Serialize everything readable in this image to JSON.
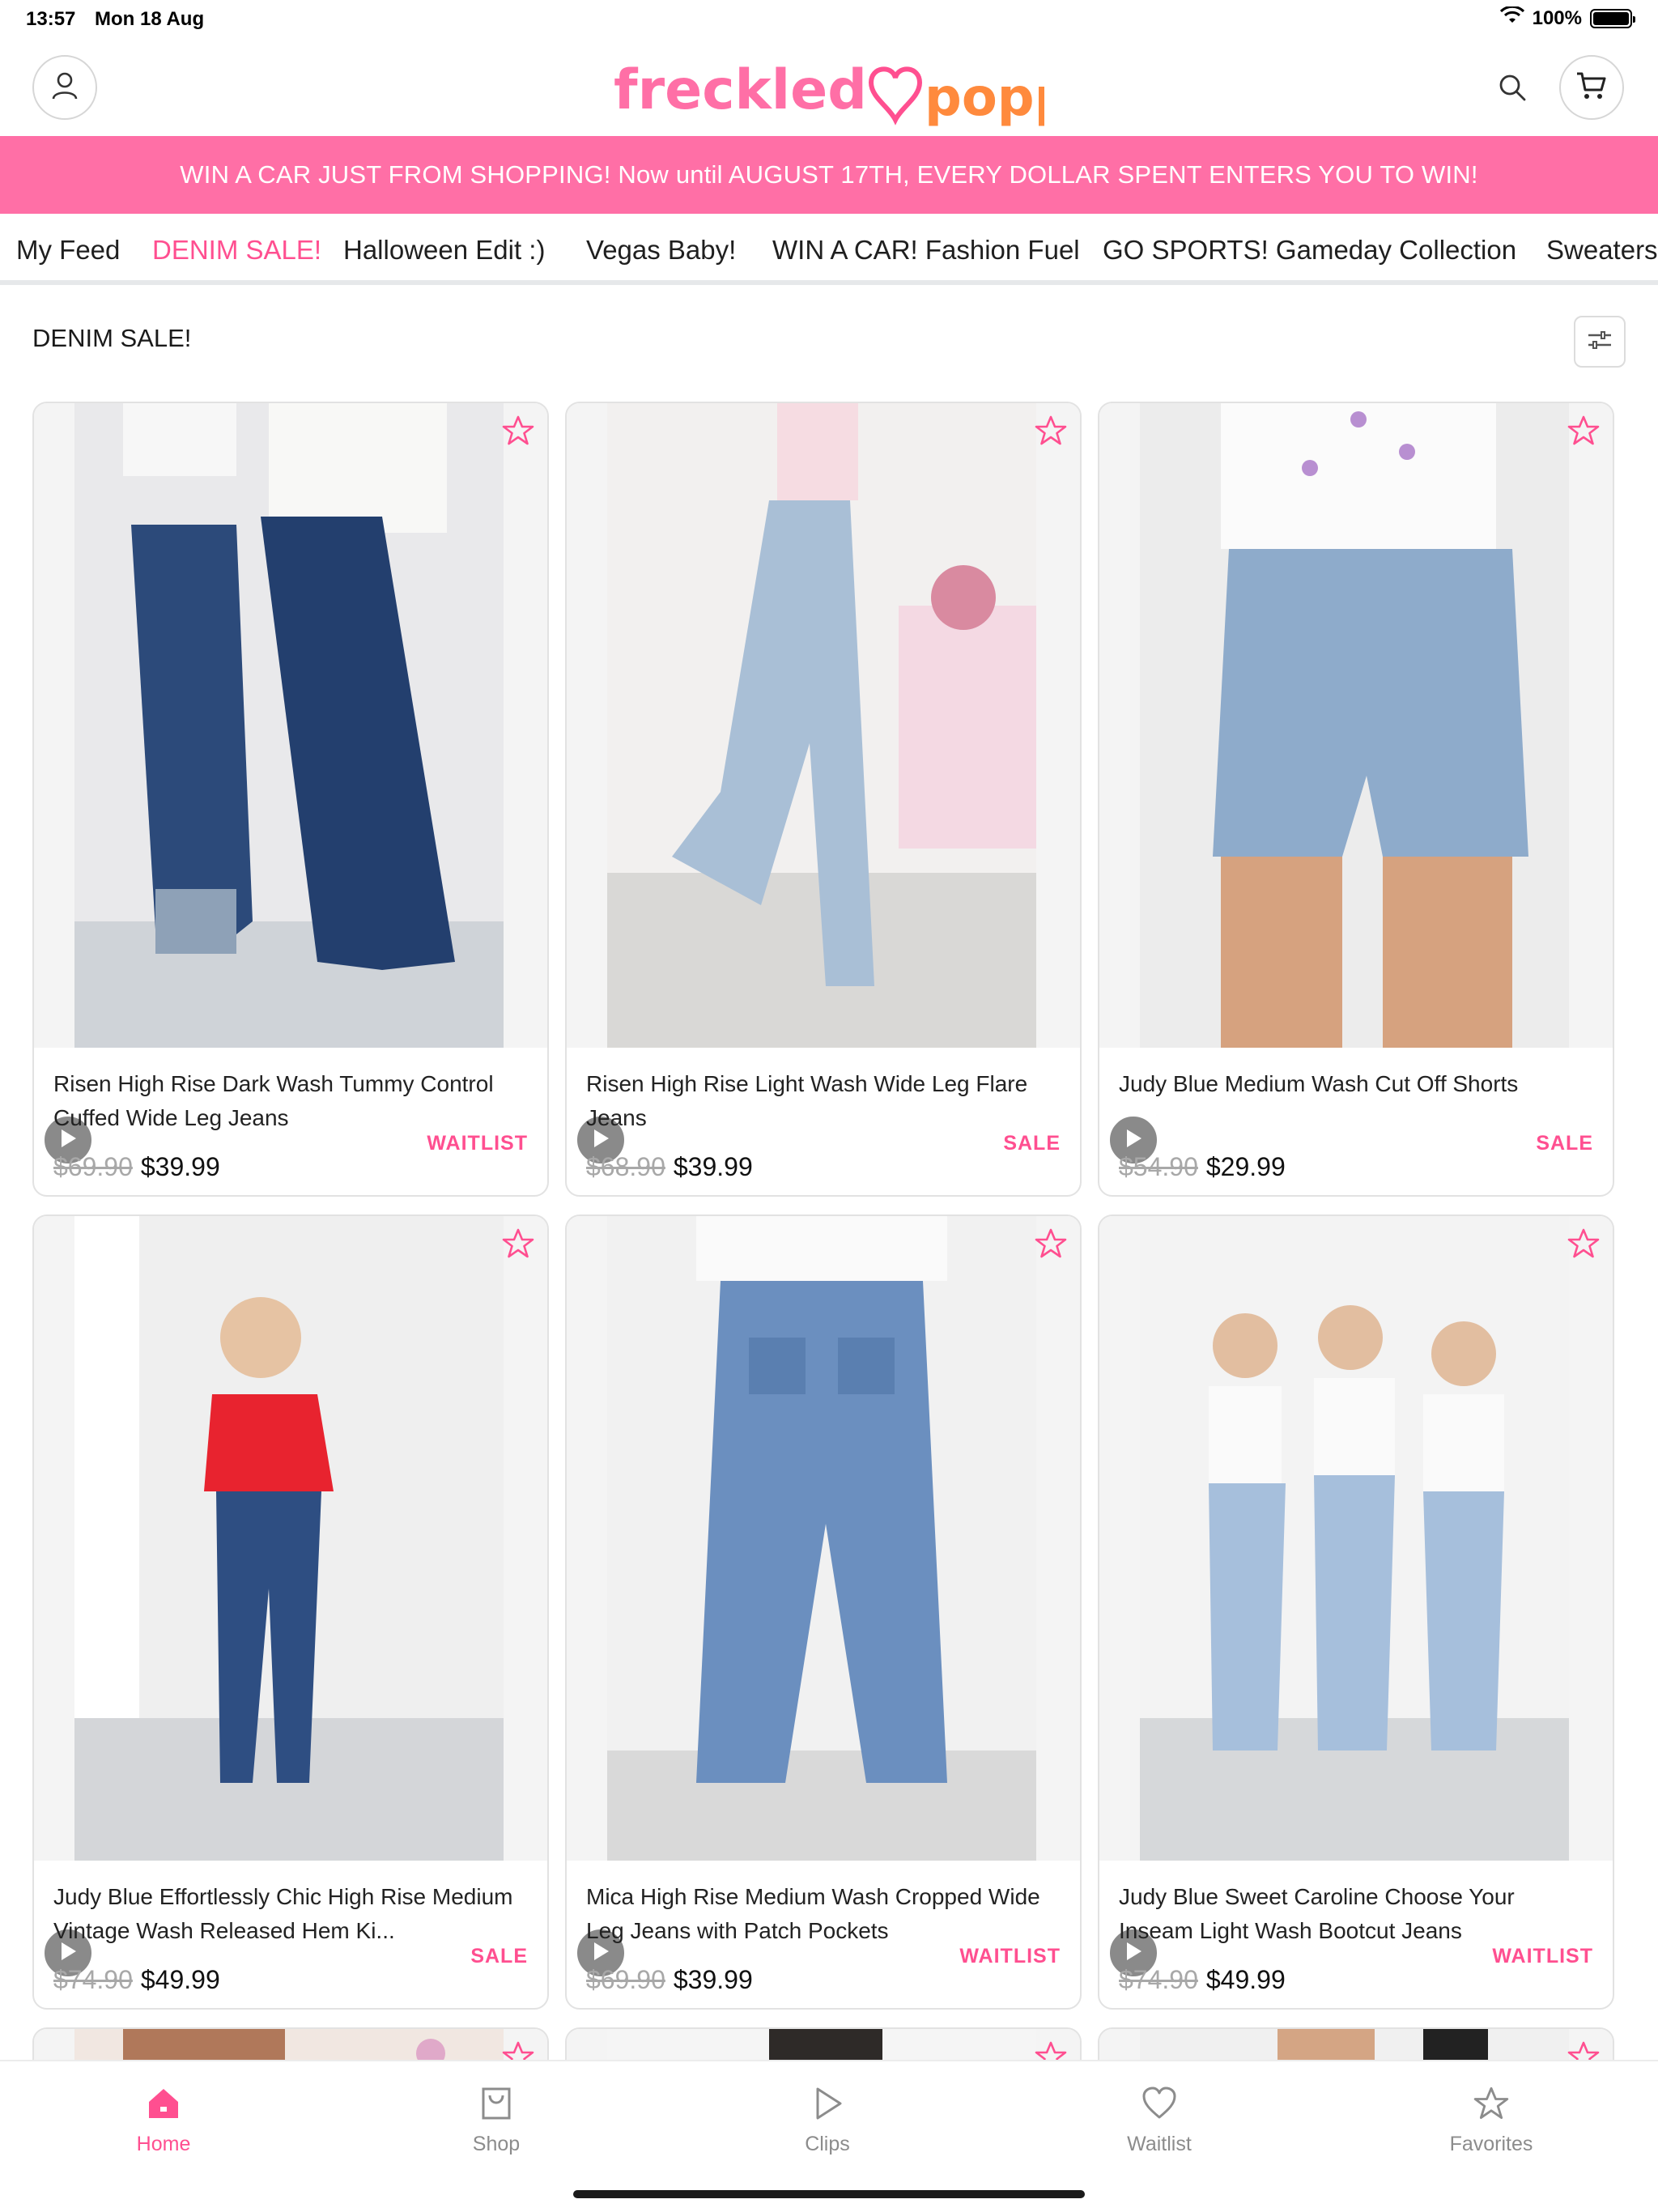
{
  "status_bar": {
    "time": "13:57",
    "date": "Mon 18 Aug",
    "battery": "100%",
    "battery_level": 1.0
  },
  "header": {
    "logo_text_1": "freckled",
    "logo_text_2": "poppy",
    "icons": {
      "account": "person-icon",
      "search": "search-icon",
      "cart": "cart-icon"
    }
  },
  "promo_banner": {
    "text": "WIN A CAR JUST FROM SHOPPING! Now until AUGUST 17TH, EVERY DOLLAR SPENT ENTERS YOU TO WIN!",
    "color": "#ff6fa6"
  },
  "tabs": [
    {
      "label": "My Feed"
    },
    {
      "label": "DENIM SALE!",
      "active": true
    },
    {
      "label": "Halloween Edit :)"
    },
    {
      "label": "Vegas Baby!"
    },
    {
      "label": "WIN A CAR! Fashion Fuel"
    },
    {
      "label": "GO SPORTS! Gameday Collection"
    },
    {
      "label": "Sweaters"
    }
  ],
  "section": {
    "title": "DENIM SALE!",
    "filter_icon": "sliders-icon"
  },
  "products": [
    {
      "title": "Risen High Rise Dark Wash Tummy Control Cuffed Wide Leg Jeans",
      "old_price": "$69.90",
      "price": "$39.99",
      "badge": "WAITLIST"
    },
    {
      "title": "Risen High Rise Light Wash Wide Leg Flare Jeans",
      "old_price": "$68.90",
      "price": "$39.99",
      "badge": "SALE"
    },
    {
      "title": "Judy Blue Medium Wash Cut Off Shorts",
      "old_price": "$54.90",
      "price": "$29.99",
      "badge": "SALE"
    },
    {
      "title": "Judy Blue Effortlessly Chic High Rise Medium Vintage Wash Released Hem Ki...",
      "old_price": "$74.90",
      "price": "$49.99",
      "badge": "SALE"
    },
    {
      "title": "Mica High Rise Medium Wash Cropped Wide Leg Jeans with Patch Pockets",
      "old_price": "$69.90",
      "price": "$39.99",
      "badge": "WAITLIST"
    },
    {
      "title": "Judy Blue Sweet Caroline Choose Your Inseam Light Wash Bootcut Jeans",
      "old_price": "$74.90",
      "price": "$49.99",
      "badge": "WAITLIST"
    }
  ],
  "bottom_nav": [
    {
      "label": "Home",
      "icon": "home-icon",
      "active": true
    },
    {
      "label": "Shop",
      "icon": "shopping-bag-icon"
    },
    {
      "label": "Clips",
      "icon": "play-icon"
    },
    {
      "label": "Waitlist",
      "icon": "heart-icon"
    },
    {
      "label": "Favorites",
      "icon": "star-icon"
    }
  ],
  "colors": {
    "accent": "#ff4f90",
    "banner": "#ff6fa6",
    "badge_text": "#ff4f90",
    "old_price": "#a8a8a8"
  }
}
